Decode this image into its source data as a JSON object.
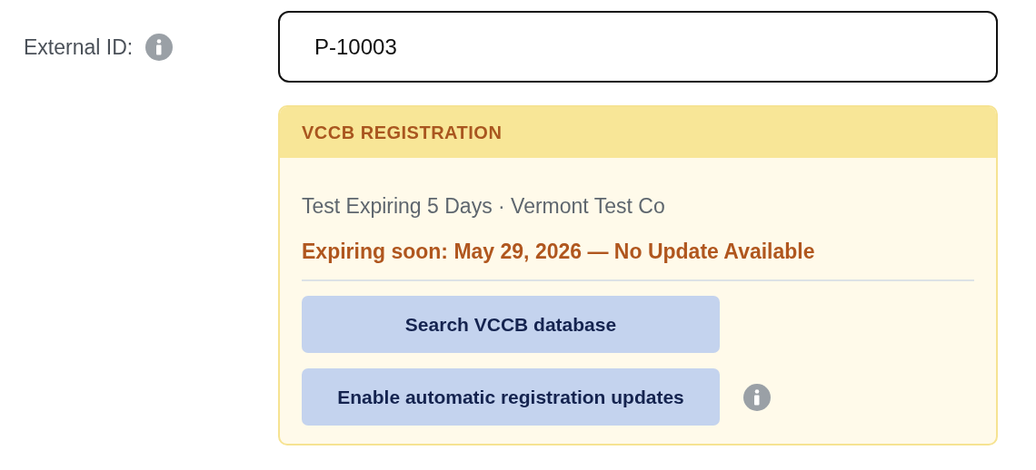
{
  "field": {
    "label": "External ID:",
    "value": "P-10003"
  },
  "panel": {
    "title": "VCCB REGISTRATION",
    "subtitle": "Test Expiring 5 Days · Vermont Test Co",
    "status": "Expiring soon: May 29, 2026 — No Update Available",
    "buttons": [
      {
        "label": "Search VCCB database",
        "info": false
      },
      {
        "label": "Enable automatic registration updates",
        "info": true
      }
    ]
  }
}
